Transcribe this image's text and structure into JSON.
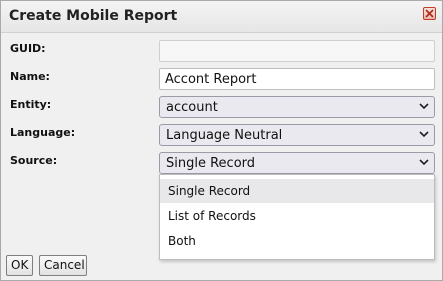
{
  "dialog": {
    "title": "Create Mobile Report"
  },
  "form": {
    "guid": {
      "label": "GUID:",
      "value": ""
    },
    "name": {
      "label": "Name:",
      "value": "Accont Report"
    },
    "entity": {
      "label": "Entity:",
      "value": "account"
    },
    "language": {
      "label": "Language:",
      "value": "Language Neutral"
    },
    "source": {
      "label": "Source:",
      "value": "Single Record"
    }
  },
  "source_dropdown": {
    "options": [
      "Single Record",
      "List of Records",
      "Both"
    ],
    "selected": "Single Record"
  },
  "buttons": {
    "ok": "OK",
    "cancel": "Cancel"
  },
  "colors": {
    "close_button": "#c23a28",
    "selected_option_bg": "#e8e8ea"
  }
}
